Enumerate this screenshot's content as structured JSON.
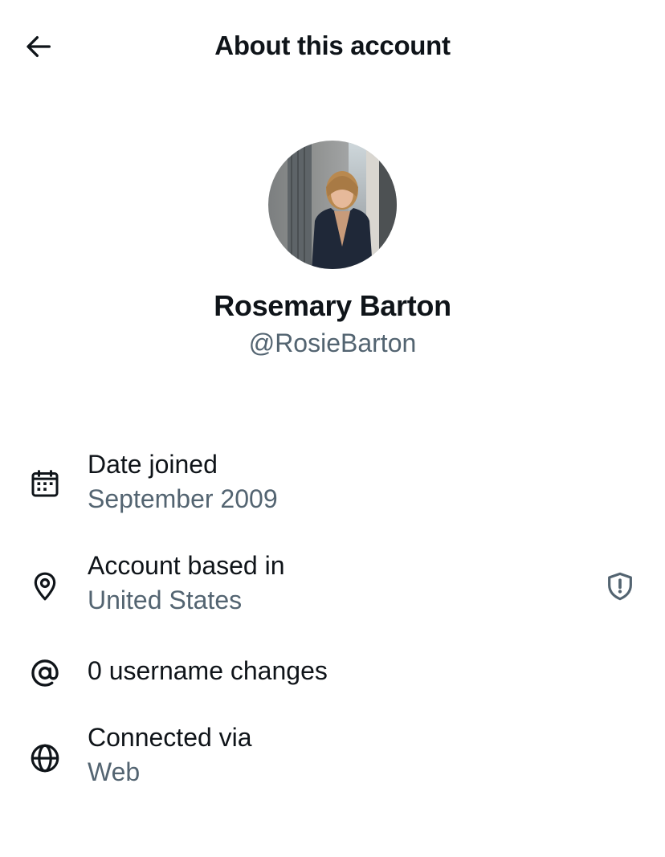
{
  "header": {
    "title": "About this account",
    "back_icon": "arrow-left-icon"
  },
  "profile": {
    "display_name": "Rosemary Barton",
    "handle": "@RosieBarton"
  },
  "details": {
    "date_joined": {
      "icon": "calendar-icon",
      "label": "Date joined",
      "value": "September 2009"
    },
    "account_based_in": {
      "icon": "location-pin-icon",
      "label": "Account based in",
      "value": "United States",
      "trailing_icon": "shield-alert-icon"
    },
    "username_changes": {
      "icon": "at-sign-icon",
      "label": "0 username changes"
    },
    "connected_via": {
      "icon": "globe-icon",
      "label": "Connected via",
      "value": "Web"
    }
  },
  "colors": {
    "primary_text": "#0f1419",
    "secondary_text": "#536471",
    "background": "#ffffff"
  }
}
